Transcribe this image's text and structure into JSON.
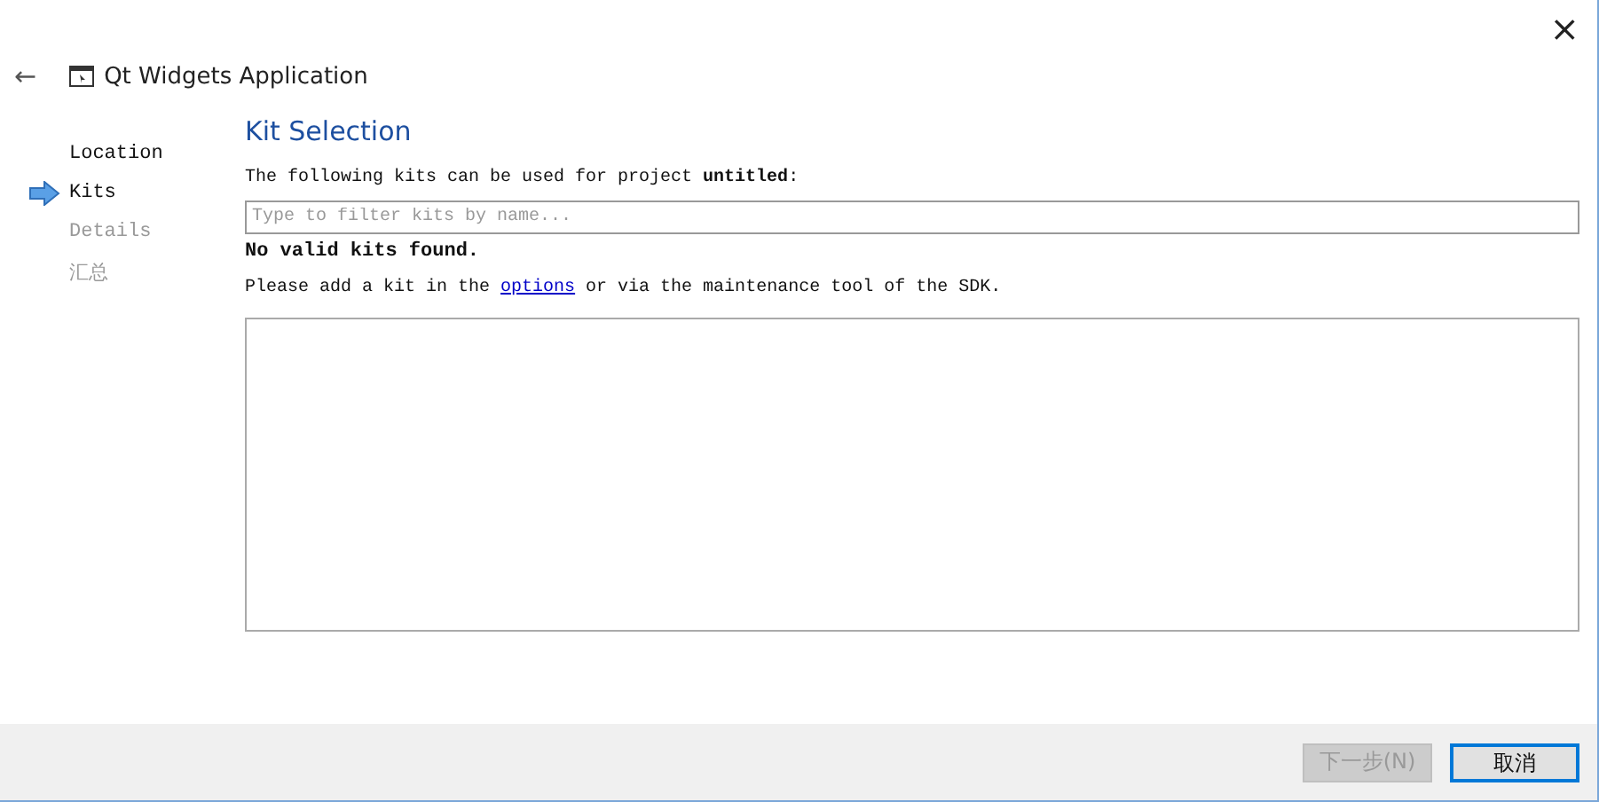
{
  "window": {
    "close": "×"
  },
  "header": {
    "back": "←",
    "title": "Qt Widgets Application"
  },
  "steps": [
    {
      "label": "Location",
      "selected": false,
      "disabled": false
    },
    {
      "label": "Kits",
      "selected": true,
      "disabled": false
    },
    {
      "label": "Details",
      "selected": false,
      "disabled": true
    },
    {
      "label": "汇总",
      "selected": false,
      "disabled": true
    }
  ],
  "page": {
    "title": "Kit Selection",
    "intro": "The following kits can be used for project **untitled**:",
    "filter": {
      "placeholder": "Type to filter kits by name..."
    },
    "warning": "No valid kits found.",
    "hint": {
      "before": "Please add a kit in the ",
      "link": "options",
      "after": " or via the maintenance tool of the SDK."
    }
  },
  "buttons": [
    {
      "label": "下一步(N)",
      "disabled": true,
      "selected": false
    },
    {
      "label": "取消",
      "disabled": false,
      "selected": true
    }
  ]
}
